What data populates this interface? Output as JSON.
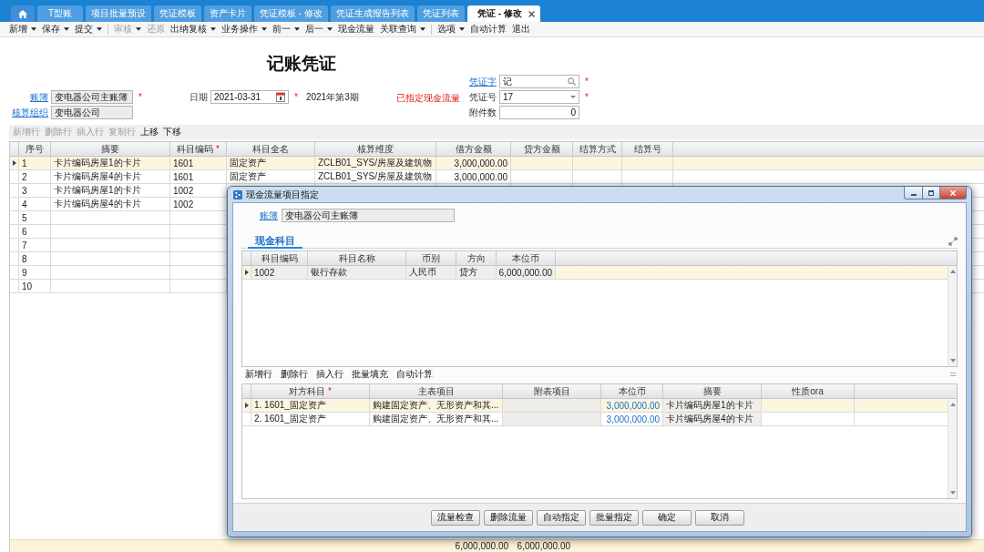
{
  "tabs": [
    {
      "kind": "home",
      "selected": false,
      "closable": false
    },
    {
      "kind": "text",
      "label": "T型账",
      "selected": false,
      "closable": false
    },
    {
      "kind": "text",
      "label": "项目批量预设",
      "selected": false,
      "closable": false
    },
    {
      "kind": "text",
      "label": "凭证模板",
      "selected": false,
      "closable": false
    },
    {
      "kind": "text",
      "label": "资产卡片",
      "selected": false,
      "closable": false
    },
    {
      "kind": "text",
      "label": "凭证模板 - 修改",
      "selected": false,
      "closable": false
    },
    {
      "kind": "text",
      "label": "凭证生成报告列表",
      "selected": false,
      "closable": false
    },
    {
      "kind": "text",
      "label": "凭证列表",
      "selected": false,
      "closable": false
    },
    {
      "kind": "text",
      "label": "凭证 - 修改",
      "selected": true,
      "closable": true
    }
  ],
  "toolbar": [
    {
      "items": [
        {
          "label": "新增",
          "dropdown": true,
          "disabled": false
        },
        {
          "label": "保存",
          "dropdown": true,
          "disabled": false
        },
        {
          "label": "提交",
          "dropdown": true,
          "disabled": false
        }
      ]
    },
    {
      "items": [
        {
          "label": "审核",
          "dropdown": true,
          "disabled": true
        },
        {
          "label": "还原",
          "dropdown": false,
          "disabled": true
        },
        {
          "label": "出纳复核",
          "dropdown": true,
          "disabled": false
        },
        {
          "label": "业务操作",
          "dropdown": true,
          "disabled": false
        },
        {
          "label": "前一",
          "dropdown": true,
          "disabled": false
        },
        {
          "label": "后一",
          "dropdown": true,
          "disabled": false
        },
        {
          "label": "现金流量",
          "dropdown": false,
          "disabled": false
        },
        {
          "label": "关联查询",
          "dropdown": true,
          "disabled": false
        }
      ]
    },
    {
      "items": [
        {
          "label": "选项",
          "dropdown": true,
          "disabled": false
        },
        {
          "label": "自动计算",
          "dropdown": false,
          "disabled": false
        },
        {
          "label": "退出",
          "dropdown": false,
          "disabled": false
        }
      ]
    }
  ],
  "voucher": {
    "title": "记账凭证",
    "voucher_word": {
      "label": "凭证字",
      "kind": "lookup",
      "value": "记",
      "link": true,
      "disabled": false,
      "mark": "*"
    },
    "book": {
      "label": "账簿",
      "kind": "text",
      "value": "变电器公司主账簿",
      "link": true,
      "disabled": true,
      "mark": "*"
    },
    "date": {
      "label": "日期",
      "kind": "date",
      "value": "2021-03-31",
      "link": false,
      "disabled": false,
      "mark": "*"
    },
    "period": "2021年第3期",
    "status": "已指定现金流量",
    "voucher_no": {
      "label": "凭证号",
      "kind": "select",
      "value": "17",
      "link": false,
      "disabled": false,
      "mark": "*"
    },
    "org": {
      "label": "核算组织",
      "kind": "text",
      "value": "变电器公司",
      "link": true,
      "disabled": true
    },
    "attachments": {
      "label": "附件数",
      "kind": "number",
      "value": "0",
      "link": false,
      "disabled": false
    }
  },
  "entry_toolbar": [
    {
      "label": "新增行",
      "disabled": true
    },
    {
      "label": "删除行",
      "disabled": true
    },
    {
      "label": "插入行",
      "disabled": true
    },
    {
      "label": "复制行",
      "disabled": true
    },
    {
      "label": "上移",
      "disabled": false
    },
    {
      "label": "下移",
      "disabled": false
    }
  ],
  "entries": {
    "columns": [
      {
        "label": "序号"
      },
      {
        "label": "摘要"
      },
      {
        "label": "科目编码",
        "mark": "*"
      },
      {
        "label": "科目全名"
      },
      {
        "label": "核算维度"
      },
      {
        "label": "借方金额"
      },
      {
        "label": "贷方金额"
      },
      {
        "label": "结算方式"
      },
      {
        "label": "结算号"
      }
    ],
    "rows": [
      {
        "selected": true,
        "seq": "1",
        "summary": "卡片编码房屋1的卡片",
        "account_code": "1601",
        "account_name": "固定资产",
        "dimension": "ZCLB01_SYS/房屋及建筑物",
        "debit": "3,000,000.00"
      },
      {
        "selected": false,
        "seq": "2",
        "summary": "卡片编码房屋4的卡片",
        "account_code": "1601",
        "account_name": "固定资产",
        "dimension": "ZCLB01_SYS/房屋及建筑物",
        "debit": "3,000,000.00"
      },
      {
        "selected": false,
        "seq": "3",
        "summary": "卡片编码房屋1的卡片",
        "account_code": "1002"
      },
      {
        "selected": false,
        "seq": "4",
        "summary": "卡片编码房屋4的卡片",
        "account_code": "1002"
      },
      {
        "selected": false,
        "seq": "5"
      },
      {
        "selected": false,
        "seq": "6"
      },
      {
        "selected": false,
        "seq": "7"
      },
      {
        "selected": false,
        "seq": "8"
      },
      {
        "selected": false,
        "seq": "9"
      },
      {
        "selected": false,
        "seq": "10"
      }
    ],
    "totals": {
      "debit": "6,000,000.00",
      "credit": "6,000,000.00"
    }
  },
  "dialog": {
    "title": "现金流量项目指定",
    "book": {
      "label": "账簿",
      "kind": "text",
      "value": "变电器公司主账簿",
      "link": true,
      "disabled": true
    },
    "tabs": [
      {
        "label": "现金科目",
        "selected": true
      }
    ],
    "cash_accounts": {
      "columns": [
        {
          "label": "科目编码",
          "readonly": true
        },
        {
          "label": "科目名称",
          "readonly": true
        },
        {
          "label": "币别",
          "readonly": true
        },
        {
          "label": "方向",
          "readonly": true
        },
        {
          "label": "本位币",
          "readonly": true
        }
      ],
      "rows": [
        {
          "selected": true,
          "code": "1002",
          "name": "银行存款",
          "currency": "人民币",
          "direction": "贷方",
          "amount": "6,000,000.00"
        }
      ]
    },
    "flow_toolbar": [
      {
        "label": "新增行",
        "disabled": false
      },
      {
        "label": "删除行",
        "disabled": false
      },
      {
        "label": "插入行",
        "disabled": false
      },
      {
        "label": "批量填充",
        "disabled": false
      },
      {
        "label": "自动计算",
        "disabled": false
      }
    ],
    "flows": {
      "columns": [
        {
          "label": "对方科目",
          "mark": "*",
          "readonly": false
        },
        {
          "label": "主表项目",
          "readonly": false
        },
        {
          "label": "附表项目",
          "readonly": true
        },
        {
          "label": "本位币",
          "readonly": false
        },
        {
          "label": "摘要",
          "readonly": true
        },
        {
          "label": "性质ora",
          "readonly": false
        }
      ],
      "rows": [
        {
          "selected": true,
          "account": "1. 1601_固定资产",
          "main_item": "购建固定资产、无形资产和其...",
          "amount": "3,000,000.00",
          "summary": "卡片编码房屋1的卡片"
        },
        {
          "selected": false,
          "account": "2. 1601_固定资产",
          "main_item": "购建固定资产、无形资产和其...",
          "amount": "3,000,000.00",
          "summary": "卡片编码房屋4的卡片"
        }
      ]
    },
    "buttons": [
      "流量检查",
      "删除流量",
      "自动指定",
      "批量指定",
      "确定",
      "取消"
    ]
  }
}
